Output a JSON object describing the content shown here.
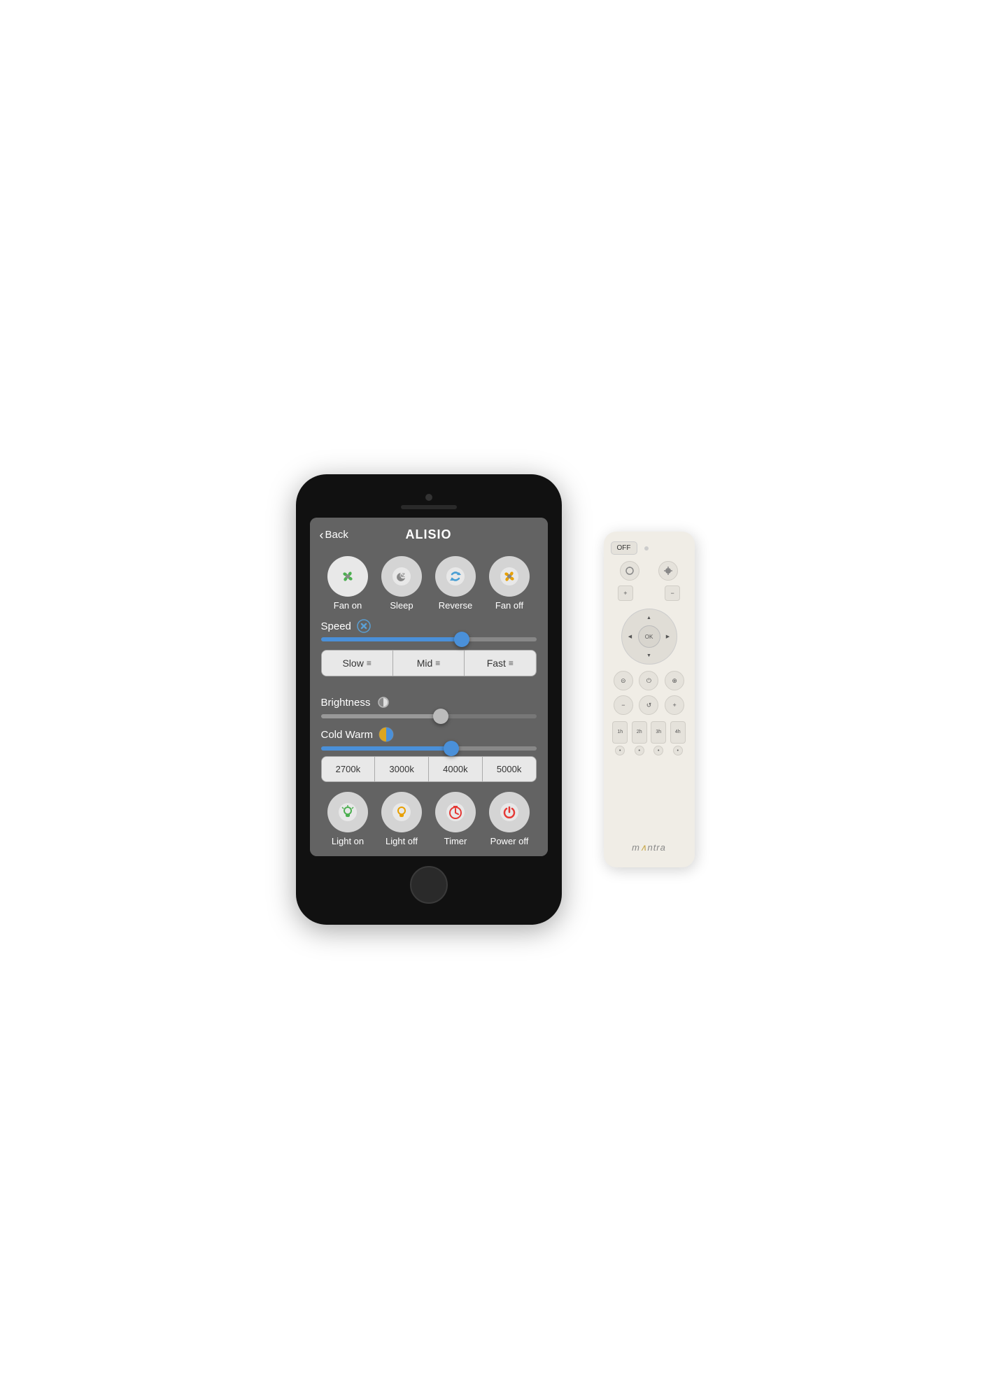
{
  "phone": {
    "header": {
      "back_label": "Back",
      "title": "ALISIO"
    },
    "fan_controls": [
      {
        "id": "fan_on",
        "label": "Fan on",
        "icon": "🌀",
        "color_active": true
      },
      {
        "id": "sleep",
        "label": "Sleep",
        "icon": "😴"
      },
      {
        "id": "reverse",
        "label": "Reverse",
        "icon": "🔄"
      },
      {
        "id": "fan_off",
        "label": "Fan off",
        "icon": "🌀",
        "color_inactive": true
      }
    ],
    "speed": {
      "label": "Speed",
      "slider_percent": 65,
      "buttons": [
        {
          "label": "Slow",
          "icon": "≡"
        },
        {
          "label": "Mid",
          "icon": "≡"
        },
        {
          "label": "Fast",
          "icon": "≡"
        }
      ]
    },
    "brightness": {
      "label": "Brightness",
      "slider_percent": 55
    },
    "cold_warm": {
      "label": "Cold Warm",
      "slider_percent": 60,
      "color_temp_buttons": [
        "2700k",
        "3000k",
        "4000k",
        "5000k"
      ]
    },
    "bottom_controls": [
      {
        "id": "light_on",
        "label": "Light on",
        "icon": "💡",
        "icon_color": "green"
      },
      {
        "id": "light_off",
        "label": "Light off",
        "icon": "💡",
        "icon_color": "orange"
      },
      {
        "id": "timer",
        "label": "Timer",
        "icon": "⏰",
        "icon_color": "red"
      },
      {
        "id": "power_off",
        "label": "Power off",
        "icon": "⏻",
        "icon_color": "red"
      }
    ]
  },
  "remote": {
    "off_label": "OFF",
    "brand": "mAntra"
  }
}
